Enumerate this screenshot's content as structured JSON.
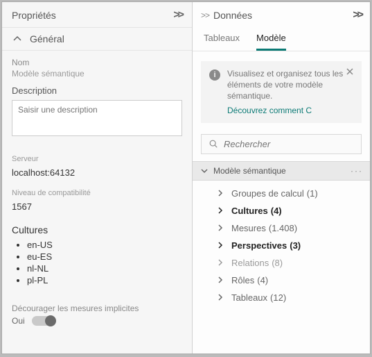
{
  "left": {
    "title": "Propriétés",
    "general_label": "Général",
    "name_label": "Nom",
    "name_value": "Modèle sémantique",
    "description_label": "Description",
    "description_placeholder": "Saisir une description",
    "server_label": "Serveur",
    "server_value": "localhost:64132",
    "compat_label": "Niveau de compatibilité",
    "compat_value": "1567",
    "cultures_label": "Cultures",
    "cultures": [
      "en-US",
      "eu-ES",
      "nl-NL",
      "pl-PL"
    ],
    "discourage_label": "Décourager les mesures implicites",
    "discourage_value_label": "Oui"
  },
  "right": {
    "title": "Données",
    "tabs": {
      "tableaux": "Tableaux",
      "modele": "Modèle"
    },
    "info": {
      "line1": "Visualisez et organisez tous les",
      "line2": "éléments de votre modèle sémantique.",
      "link": "Découvrez comment C"
    },
    "search_placeholder": "Rechercher",
    "tree_root": "Modèle sémantique",
    "tree": [
      {
        "label": "Groupes de calcul",
        "count": "(1)",
        "style": "normal"
      },
      {
        "label": "Cultures",
        "count": "(4)",
        "style": "bold"
      },
      {
        "label": "Mesures",
        "count": "(1.408)",
        "style": "normal"
      },
      {
        "label": "Perspectives",
        "count": "(3)",
        "style": "bold"
      },
      {
        "label": "Relations",
        "count": "(8)",
        "style": "light"
      },
      {
        "label": "Rôles",
        "count": "(4)",
        "style": "normal"
      },
      {
        "label": "Tableaux",
        "count": "(12)",
        "style": "normal"
      }
    ]
  }
}
